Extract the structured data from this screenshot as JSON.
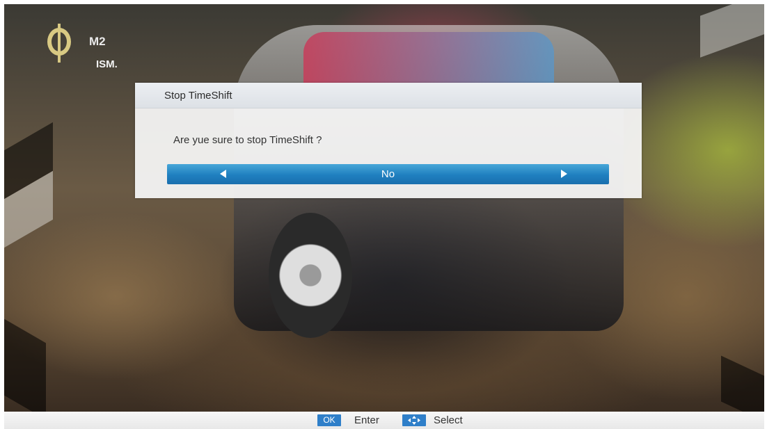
{
  "channel": {
    "name": "M2",
    "sub_label": "ISM."
  },
  "dialog": {
    "title": "Stop TimeShift",
    "message": "Are yue sure to stop TimeShift ?",
    "selected_option": "No"
  },
  "help_bar": {
    "ok_key": "OK",
    "enter_label": "Enter",
    "select_label": "Select"
  },
  "colors": {
    "accent_blue": "#1f7fbf",
    "logo_gold": "#d8c983"
  }
}
